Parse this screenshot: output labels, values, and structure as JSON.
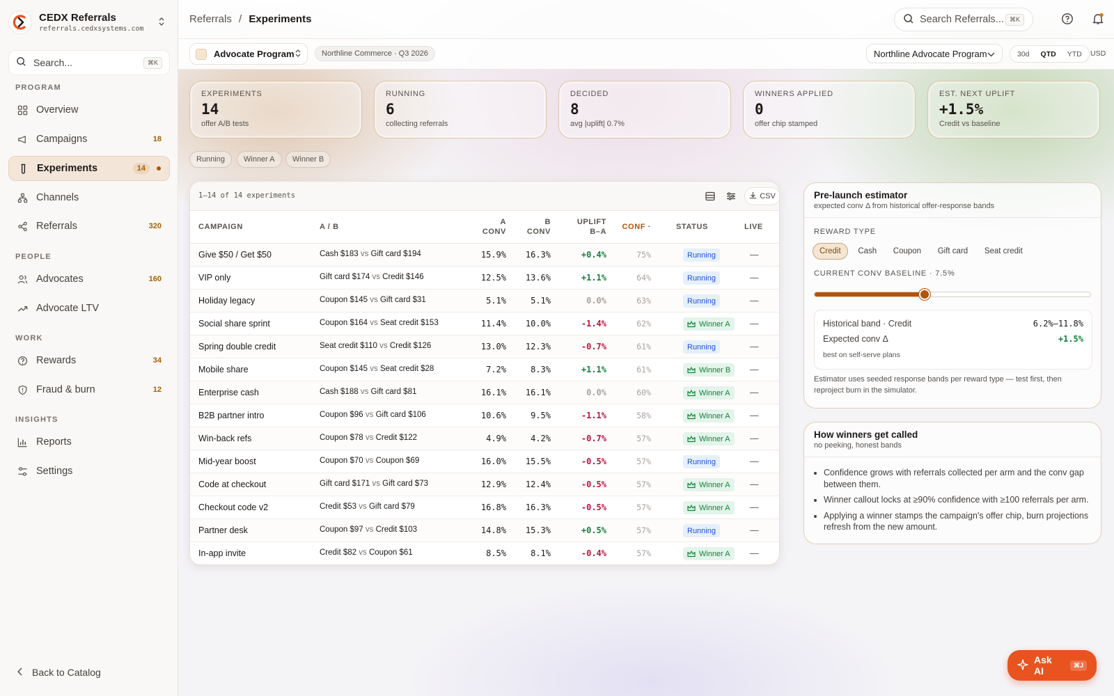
{
  "brand": {
    "name": "CEDX Referrals",
    "url": "referrals.cedxsystems.com"
  },
  "sidebar": {
    "search_placeholder": "Search...",
    "search_kbd": "⌘K",
    "sections": {
      "program": "PROGRAM",
      "people": "PEOPLE",
      "work": "WORK",
      "insights": "INSIGHTS"
    },
    "items": [
      {
        "label": "Overview",
        "count": ""
      },
      {
        "label": "Campaigns",
        "count": "18"
      },
      {
        "label": "Experiments",
        "count": "14"
      },
      {
        "label": "Channels",
        "count": ""
      },
      {
        "label": "Referrals",
        "count": "320"
      },
      {
        "label": "Advocates",
        "count": "160"
      },
      {
        "label": "Advocate LTV",
        "count": ""
      },
      {
        "label": "Rewards",
        "count": "34"
      },
      {
        "label": "Fraud & burn",
        "count": "12"
      },
      {
        "label": "Reports",
        "count": ""
      },
      {
        "label": "Settings",
        "count": ""
      }
    ],
    "back": "Back to Catalog"
  },
  "topbar": {
    "crumb_parent": "Referrals",
    "crumb_sep": "/",
    "crumb_current": "Experiments",
    "search_placeholder": "Search Referrals...",
    "search_kbd": "⌘K"
  },
  "subbar": {
    "program": "Advocate Program",
    "context": "Northline Commerce · Q3 2026",
    "program_drop": "Northline Advocate Program",
    "ranges": [
      "30d",
      "QTD",
      "YTD"
    ],
    "range_selected": "QTD",
    "currency": "USD"
  },
  "kpis": [
    {
      "label": "EXPERIMENTS",
      "value": "14",
      "sub": "offer A/B tests"
    },
    {
      "label": "RUNNING",
      "value": "6",
      "sub": "collecting referrals"
    },
    {
      "label": "DECIDED",
      "value": "8",
      "sub": "avg |uplift| 0.7%"
    },
    {
      "label": "WINNERS APPLIED",
      "value": "0",
      "sub": "offer chip stamped"
    },
    {
      "label": "EST. NEXT UPLIFT",
      "value": "+1.5%",
      "sub": "Credit vs baseline"
    }
  ],
  "filters": [
    "Running",
    "Winner A",
    "Winner B"
  ],
  "table": {
    "count": "1–14 of 14 experiments",
    "csv": "CSV",
    "columns": {
      "campaign": "CAMPAIGN",
      "ab": "A / B",
      "a1": "A",
      "a2": "CONV",
      "b1": "B",
      "b2": "CONV",
      "u1": "UPLIFT",
      "u2": "B–A",
      "conf": "CONF ·",
      "status": "STATUS",
      "live": "LIVE"
    },
    "vs": "vs",
    "rows": [
      {
        "campaign": "Give $50 / Get $50",
        "a": "Cash $183",
        "b": "Gift card $194",
        "aconv": "15.9%",
        "bconv": "16.3%",
        "uplift": "+0.4%",
        "conf": "75%",
        "status": "Running",
        "live": "—"
      },
      {
        "campaign": "VIP only",
        "a": "Gift card $174",
        "b": "Credit $146",
        "aconv": "12.5%",
        "bconv": "13.6%",
        "uplift": "+1.1%",
        "conf": "64%",
        "status": "Running",
        "live": "—"
      },
      {
        "campaign": "Holiday legacy",
        "a": "Coupon $145",
        "b": "Gift card $31",
        "aconv": "5.1%",
        "bconv": "5.1%",
        "uplift": "0.0%",
        "conf": "63%",
        "status": "Running",
        "live": "—"
      },
      {
        "campaign": "Social share sprint",
        "a": "Coupon $164",
        "b": "Seat credit $153",
        "aconv": "11.4%",
        "bconv": "10.0%",
        "uplift": "-1.4%",
        "conf": "62%",
        "status": "Winner A",
        "live": "—"
      },
      {
        "campaign": "Spring double credit",
        "a": "Seat credit $110",
        "b": "Credit $126",
        "aconv": "13.0%",
        "bconv": "12.3%",
        "uplift": "-0.7%",
        "conf": "61%",
        "status": "Running",
        "live": "—"
      },
      {
        "campaign": "Mobile share",
        "a": "Coupon $145",
        "b": "Seat credit $28",
        "aconv": "7.2%",
        "bconv": "8.3%",
        "uplift": "+1.1%",
        "conf": "61%",
        "status": "Winner B",
        "live": "—"
      },
      {
        "campaign": "Enterprise cash",
        "a": "Cash $188",
        "b": "Gift card $81",
        "aconv": "16.1%",
        "bconv": "16.1%",
        "uplift": "0.0%",
        "conf": "60%",
        "status": "Winner A",
        "live": "—"
      },
      {
        "campaign": "B2B partner intro",
        "a": "Coupon $96",
        "b": "Gift card $106",
        "aconv": "10.6%",
        "bconv": "9.5%",
        "uplift": "-1.1%",
        "conf": "58%",
        "status": "Winner A",
        "live": "—"
      },
      {
        "campaign": "Win-back refs",
        "a": "Coupon $78",
        "b": "Credit $122",
        "aconv": "4.9%",
        "bconv": "4.2%",
        "uplift": "-0.7%",
        "conf": "57%",
        "status": "Winner A",
        "live": "—"
      },
      {
        "campaign": "Mid-year boost",
        "a": "Coupon $70",
        "b": "Coupon $69",
        "aconv": "16.0%",
        "bconv": "15.5%",
        "uplift": "-0.5%",
        "conf": "57%",
        "status": "Running",
        "live": "—"
      },
      {
        "campaign": "Code at checkout",
        "a": "Gift card $171",
        "b": "Gift card $73",
        "aconv": "12.9%",
        "bconv": "12.4%",
        "uplift": "-0.5%",
        "conf": "57%",
        "status": "Winner A",
        "live": "—"
      },
      {
        "campaign": "Checkout code v2",
        "a": "Credit $53",
        "b": "Gift card $79",
        "aconv": "16.8%",
        "bconv": "16.3%",
        "uplift": "-0.5%",
        "conf": "57%",
        "status": "Winner A",
        "live": "—"
      },
      {
        "campaign": "Partner desk",
        "a": "Coupon $97",
        "b": "Credit $103",
        "aconv": "14.8%",
        "bconv": "15.3%",
        "uplift": "+0.5%",
        "conf": "57%",
        "status": "Running",
        "live": "—"
      },
      {
        "campaign": "In-app invite",
        "a": "Credit $82",
        "b": "Coupon $61",
        "aconv": "8.5%",
        "bconv": "8.1%",
        "uplift": "-0.4%",
        "conf": "57%",
        "status": "Winner A",
        "live": "—"
      }
    ]
  },
  "estimator": {
    "title": "Pre-launch estimator",
    "subtitle": "expected conv Δ from historical offer-response bands",
    "reward_label": "REWARD TYPE",
    "reward_types": [
      "Credit",
      "Cash",
      "Coupon",
      "Gift card",
      "Seat credit"
    ],
    "reward_selected": "Credit",
    "baseline_label": "CURRENT CONV BASELINE · 7.5%",
    "baseline_fraction": 0.4,
    "band_label": "Historical band · Credit",
    "band_value": "6.2%–11.8%",
    "expected_label": "Expected conv Δ",
    "expected_value": "+1.5%",
    "expected_note": "best on self-serve plans",
    "note": "Estimator uses seeded response bands per reward type — test first, then reproject burn in the simulator."
  },
  "winners": {
    "title": "How winners get called",
    "subtitle": "no peeking, honest bands",
    "bullets": [
      "Confidence grows with referrals collected per arm and the conv gap between them.",
      "Winner callout locks at ≥90% confidence with ≥100 referrals per arm.",
      "Applying a winner stamps the campaign's offer chip, burn projections refresh from the new amount."
    ]
  },
  "askai": {
    "label": "Ask AI",
    "kbd": "⌘J"
  },
  "colors": {
    "accent": "#b45309",
    "positive": "#15803d",
    "negative": "#be123c",
    "askai": "#e8531f"
  }
}
